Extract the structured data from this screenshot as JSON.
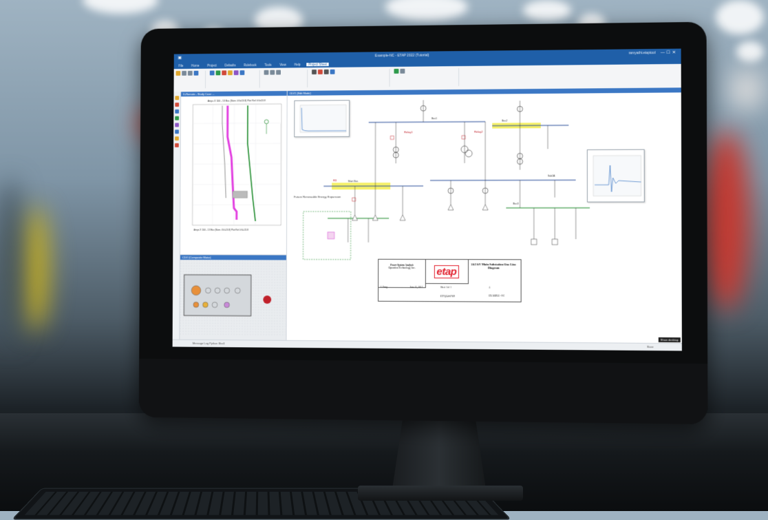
{
  "window": {
    "title": "Example-NC - ETAP 2022 (Tutorial)",
    "user": "ramyathi.etaptool",
    "controls": [
      "—",
      "☐",
      "✕"
    ]
  },
  "ribbon": {
    "tabs": [
      "File",
      "Home",
      "Project",
      "Defaults",
      "Rulebook",
      "Tools",
      "View",
      "Help",
      "Project Sheet"
    ],
    "active_tab": "Project Sheet"
  },
  "panels": {
    "tcc_title": "D-Remote - Study Case ...",
    "tcc_footer": "Amps X 100 - 13 Bus (Nom. kV=13.8) Plot Ref. kV=13.8",
    "tcc_header": "Amps X 100 - 13 Bus (Nom. kV=13.8) Plot Ref. kV=13.8",
    "panel2_title": "CDO (Composite Motor)",
    "diagram_title": "OLV1 (Edit Mode)"
  },
  "diagram": {
    "side_label": "Future Renewable Energy Expansion",
    "buses": [
      "Bus1",
      "Main Bus",
      "Bus2",
      "Sub2A",
      "Bus3"
    ],
    "relay_labels": [
      "Relay1",
      "Relay2",
      "R3"
    ]
  },
  "title_block": {
    "company": "Power System Analysis",
    "company_sub": "Operation Technology, Inc.",
    "logo": "etap",
    "drawing_title": "24.5 kV Main Substation One Line Diagram",
    "drawn_by": "J. Fong",
    "date": "June 15, 2017",
    "sheet": "Sheet 1 of 1",
    "revision": "A",
    "drawing_no": "ETQ24-0709",
    "filename": "EXAMPLE - NC"
  },
  "status": {
    "text": "Message Log  Python Shell",
    "tooltip": "Show desktop",
    "right": "Base"
  },
  "colors": {
    "titlebar": "#1f5fa8",
    "bus_highlight": "#f5f06a",
    "curve_magenta": "#e23ee0",
    "curve_green": "#1c8a2a",
    "breaker_red": "#c0202a",
    "etap_red": "#e21d2b"
  }
}
